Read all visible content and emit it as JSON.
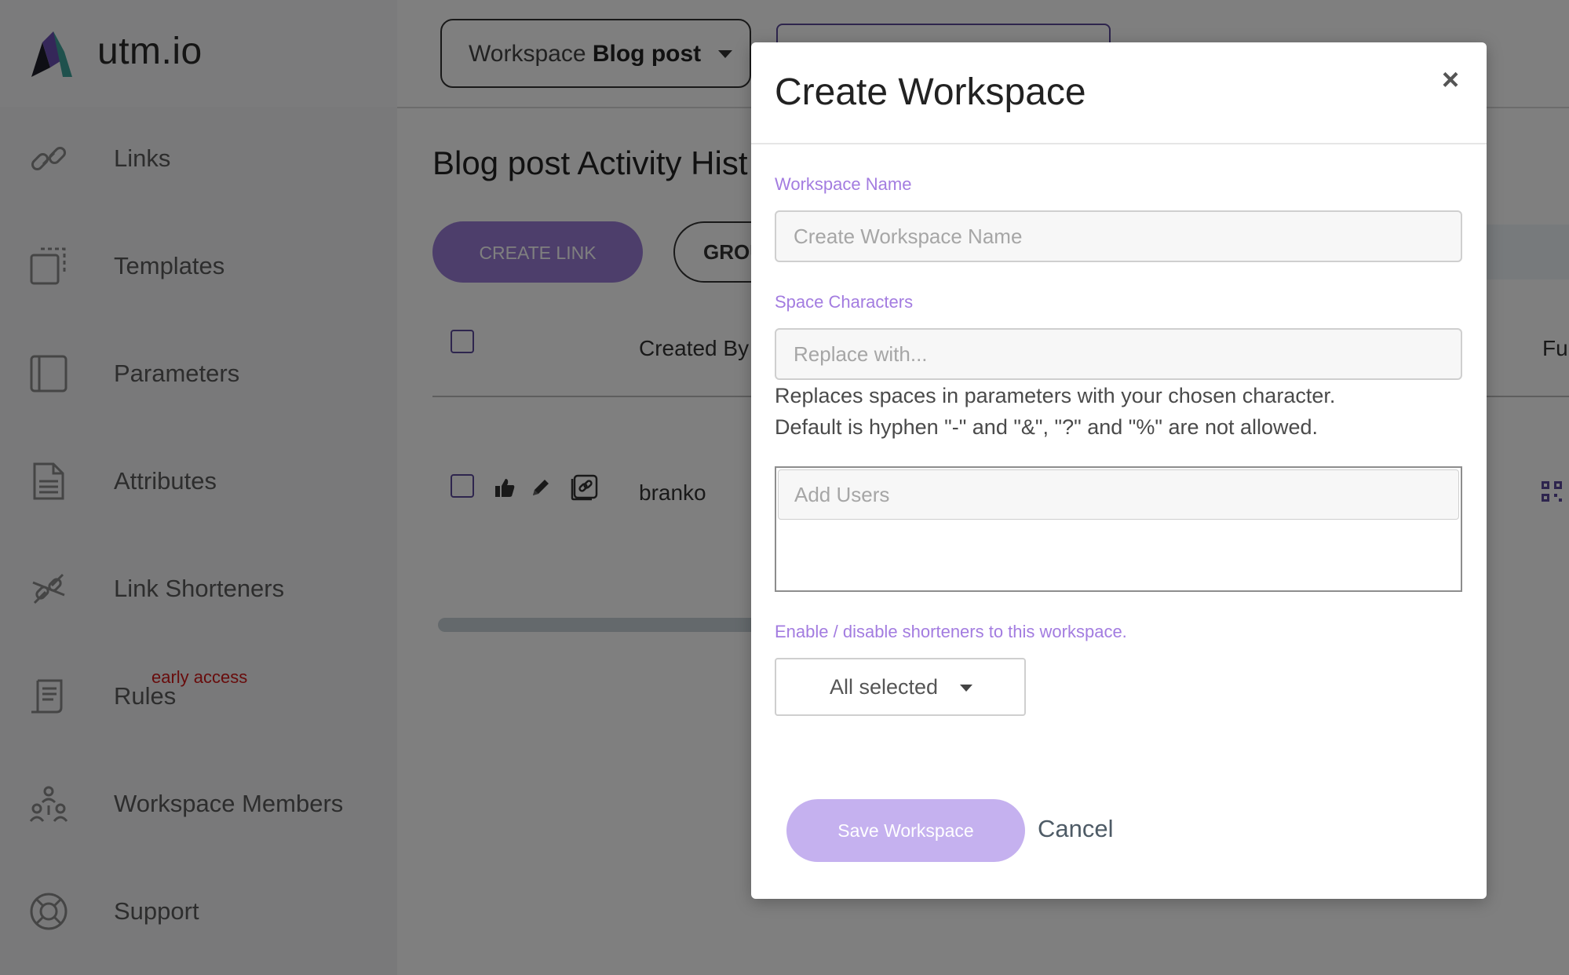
{
  "app": {
    "logo_text": "utm.io"
  },
  "sidebar": {
    "items": [
      {
        "label": "Links",
        "icon": "link-icon"
      },
      {
        "label": "Templates",
        "icon": "templates-icon"
      },
      {
        "label": "Parameters",
        "icon": "parameters-icon"
      },
      {
        "label": "Attributes",
        "icon": "document-icon"
      },
      {
        "label": "Link Shorteners",
        "icon": "broken-link-icon"
      },
      {
        "label": "Rules",
        "icon": "scroll-icon",
        "badge": "early access"
      },
      {
        "label": "Workspace Members",
        "icon": "team-icon"
      },
      {
        "label": "Support",
        "icon": "lifebuoy-icon"
      }
    ]
  },
  "header": {
    "workspace_prefix": "Workspace",
    "workspace_name": "Blog post"
  },
  "main": {
    "title": "Blog post Activity Hist",
    "create_link_label": "CREATE LINK",
    "group_label": "GROU",
    "table": {
      "columns": [
        "Created By",
        "Ful"
      ],
      "rows": [
        {
          "created_by": "branko"
        }
      ]
    }
  },
  "modal": {
    "title": "Create Workspace",
    "close_label": "×",
    "workspace_name_label": "Workspace Name",
    "workspace_name_placeholder": "Create Workspace Name",
    "workspace_name_value": "",
    "space_chars_label": "Space Characters",
    "space_chars_placeholder": "Replace with...",
    "space_chars_value": "",
    "help_line1": "Replaces spaces in parameters with your chosen character.",
    "help_line2": "Default is hyphen \"-\" and \"&\", \"?\" and \"%\" are not allowed.",
    "add_users_placeholder": "Add Users",
    "shorteners_label": "Enable / disable shorteners to this workspace.",
    "shorteners_value": "All selected",
    "save_label": "Save Workspace",
    "cancel_label": "Cancel"
  },
  "colors": {
    "accent_purple": "#9b7dd6",
    "label_purple": "#a37ce0",
    "save_button_disabled": "#c5b1ef",
    "badge_red": "#d01818"
  }
}
